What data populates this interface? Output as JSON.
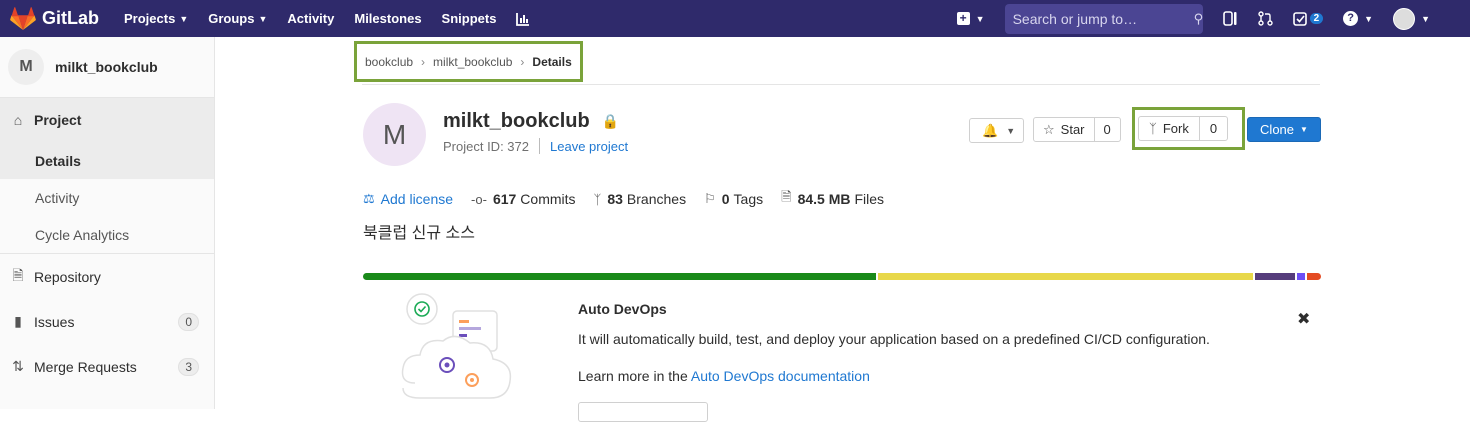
{
  "navbar": {
    "brand": "GitLab",
    "links": [
      {
        "label": "Projects",
        "dropdown": true
      },
      {
        "label": "Groups",
        "dropdown": true
      },
      {
        "label": "Activity",
        "dropdown": false
      },
      {
        "label": "Milestones",
        "dropdown": false
      },
      {
        "label": "Snippets",
        "dropdown": false
      }
    ],
    "search_placeholder": "Search or jump to…",
    "todo_count": "2",
    "brand_color": "#2f2a6b"
  },
  "sidebar": {
    "project_initial": "M",
    "project_name": "milkt_bookclub",
    "project_label": "Project",
    "project_sub": [
      "Details",
      "Activity",
      "Cycle Analytics"
    ],
    "repository": "Repository",
    "issues": "Issues",
    "issues_count": "0",
    "merge_requests": "Merge Requests",
    "merge_requests_count": "3"
  },
  "breadcrumb": {
    "items": [
      "bookclub",
      "milkt_bookclub"
    ],
    "current": "Details"
  },
  "project": {
    "initial": "M",
    "name": "milkt_bookclub",
    "id_text": "Project ID: 372",
    "leave": "Leave project",
    "star_label": "Star",
    "star_count": "0",
    "fork_label": "Fork",
    "fork_count": "0",
    "clone_label": "Clone",
    "description": "북클럽 신규 소스"
  },
  "stats": {
    "license": "Add license",
    "commits_count": "617",
    "commits_label": "Commits",
    "branches_count": "83",
    "branches_label": "Branches",
    "tags_count": "0",
    "tags_label": "Tags",
    "files_size": "84.5 MB",
    "files_label": "Files"
  },
  "language_bar": [
    {
      "color": "#1a8a1a",
      "share": 0.54
    },
    {
      "color": "#e8d84a",
      "share": 0.395
    },
    {
      "color": "#563d7c",
      "share": 0.042
    },
    {
      "color": "#6e4ff6",
      "share": 0.008
    },
    {
      "color": "#e44b23",
      "share": 0.015
    }
  ],
  "devops": {
    "title": "Auto DevOps",
    "text": "It will automatically build, test, and deploy your application based on a predefined CI/CD configuration.",
    "learn_prefix": "Learn more in the",
    "learn_link": "Auto DevOps documentation"
  }
}
